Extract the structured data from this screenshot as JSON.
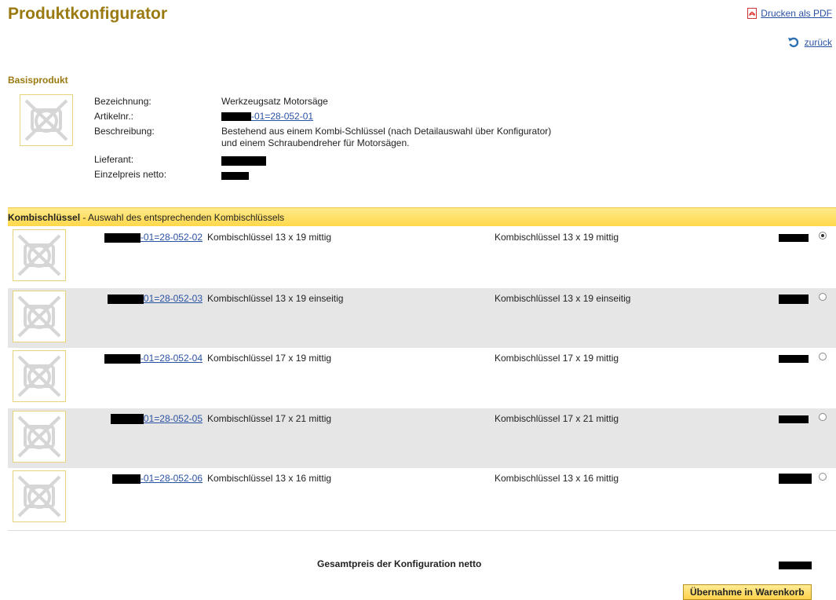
{
  "header": {
    "title": "Produktkonfigurator",
    "pdf_link": "Drucken als PDF",
    "back_link": "zurück"
  },
  "basisprodukt": {
    "heading": "Basisprodukt",
    "labels": {
      "bezeichnung": "Bezeichnung:",
      "artikelnr": "Artikelnr.:",
      "beschreibung": "Beschreibung:",
      "lieferant": "Lieferant:",
      "einzelpreis": "Einzelpreis netto:"
    },
    "bezeichnung": "Werkzeugsatz Motorsäge",
    "artikelnr_suffix": "-01=28-052-01",
    "beschreibung_line1": "Bestehend aus einem Kombi-Schlüssel (nach Detailauswahl über Konfigurator)",
    "beschreibung_line2": "und einem Schraubendreher für Motorsägen."
  },
  "kombischluessel": {
    "heading": "Kombischlüssel",
    "subheading": " - Auswahl des entsprechenden Kombischlüssels",
    "options": [
      {
        "code": "-01=28-052-02",
        "name": "Kombischlüssel 13 x 19 mittig",
        "desc": "Kombischlüssel 13 x 19 mittig",
        "selected": true
      },
      {
        "code": "01=28-052-03",
        "name": "Kombischlüssel 13 x 19 einseitig",
        "desc": "Kombischlüssel 13 x 19 einseitig",
        "selected": false
      },
      {
        "code": "-01=28-052-04",
        "name": "Kombischlüssel 17 x 19 mittig",
        "desc": "Kombischlüssel 17 x 19 mittig",
        "selected": false
      },
      {
        "code": "01=28-052-05",
        "name": "Kombischlüssel 17 x 21 mittig",
        "desc": "Kombischlüssel 17 x 21 mittig",
        "selected": false
      },
      {
        "code": "-01=28-052-06",
        "name": "Kombischlüssel 13 x 16 mittig",
        "desc": "Kombischlüssel 13 x 16 mittig",
        "selected": false
      }
    ]
  },
  "footer": {
    "total_label": "Gesamtpreis der Konfiguration netto",
    "cart_button": "Übernahme in Warenkorb"
  },
  "colors": {
    "title": "#9a7a10",
    "link": "#2a52a3",
    "band": "#ffd84a",
    "alt_row": "#e6e6e6"
  }
}
